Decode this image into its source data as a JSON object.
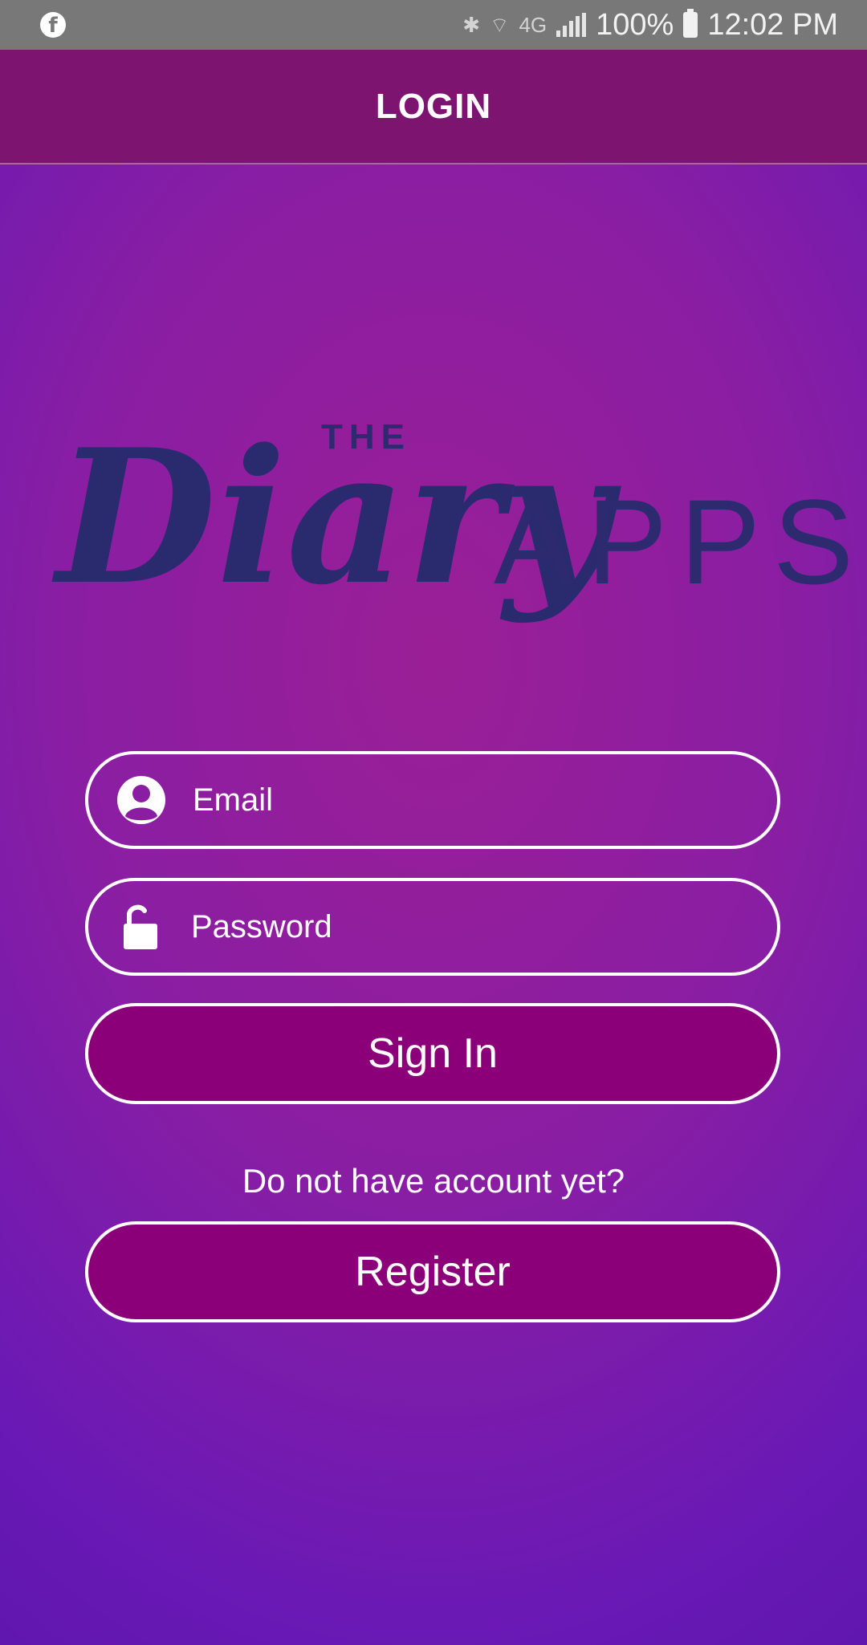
{
  "status_bar": {
    "battery": "100%",
    "time": "12:02 PM",
    "network": "4G"
  },
  "app_bar": {
    "title": "LOGIN"
  },
  "logo": {
    "the": "THE",
    "diary": "Diary",
    "apps": "APPS"
  },
  "form": {
    "email_placeholder": "Email",
    "password_placeholder": "Password",
    "signin_label": "Sign In",
    "no_account_text": "Do not have account yet?",
    "register_label": "Register"
  },
  "colors": {
    "app_bar": "#7c1470",
    "button": "#8b0079",
    "logo": "#2a2a6e",
    "status_bar": "#787878"
  },
  "icons": [
    "facebook-icon",
    "bluetooth-icon",
    "wifi-icon",
    "signal-icon",
    "battery-icon",
    "user-icon",
    "lock-icon"
  ]
}
